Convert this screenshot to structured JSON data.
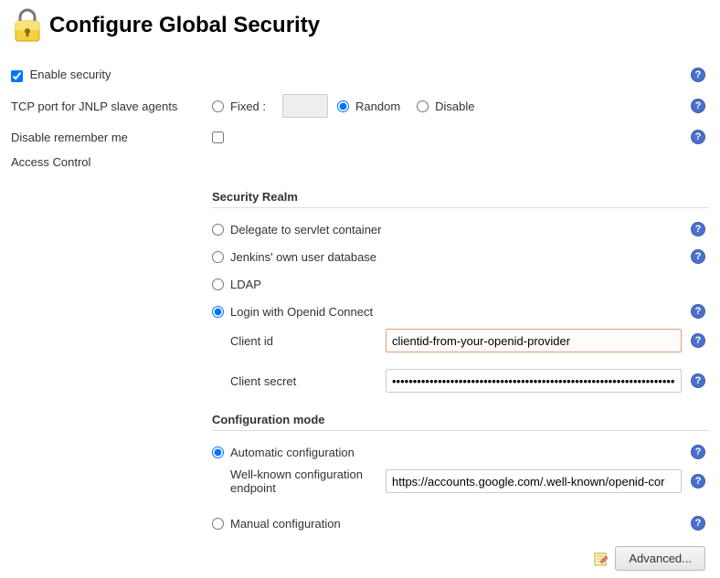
{
  "page_title": "Configure Global Security",
  "enable_security": {
    "label": "Enable security",
    "checked": true
  },
  "tcp_port": {
    "label": "TCP port for JNLP slave agents",
    "fixed_label": "Fixed :",
    "random_label": "Random",
    "disable_label": "Disable",
    "selected": "random",
    "fixed_value": ""
  },
  "disable_remember": {
    "label": "Disable remember me",
    "checked": false
  },
  "access_control": {
    "label": "Access Control"
  },
  "security_realm": {
    "heading": "Security Realm",
    "options": {
      "servlet": {
        "label": "Delegate to servlet container",
        "selected": false
      },
      "jenkins": {
        "label": "Jenkins' own user database",
        "selected": false
      },
      "ldap": {
        "label": "LDAP",
        "selected": false
      },
      "openid": {
        "label": "Login with Openid Connect",
        "selected": true
      }
    },
    "client_id": {
      "label": "Client id",
      "value": "clientid-from-your-openid-provider"
    },
    "client_secret": {
      "label": "Client secret",
      "value": "••••••••••••••••••••••••••••••••••••••••••••••••••••••••••••••••••••••••••••"
    }
  },
  "config_mode": {
    "heading": "Configuration mode",
    "auto": {
      "label": "Automatic configuration",
      "selected": true
    },
    "wellknown": {
      "label": "Well-known configuration endpoint",
      "value": "https://accounts.google.com/.well-known/openid-cor"
    },
    "manual": {
      "label": "Manual configuration",
      "selected": false
    }
  },
  "advanced_button": "Advanced..."
}
